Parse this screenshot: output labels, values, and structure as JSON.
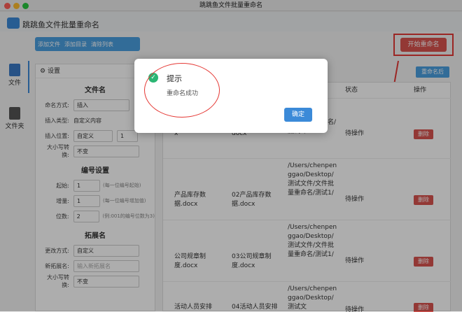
{
  "window": {
    "title": "跳跳鱼文件批量重命名"
  },
  "header": {
    "app_title": "跳跳鱼文件批量重命名"
  },
  "toolbar": {
    "add_file": "添加文件",
    "add_dir": "添加目录",
    "clear_list": "清除列表",
    "start_rename": "开始重命名"
  },
  "sidebar": {
    "items": [
      {
        "label": "文件"
      },
      {
        "label": "文件夹"
      }
    ]
  },
  "settings": {
    "header": "设置",
    "filename_section": "文件名",
    "name_mode_label": "命名方式:",
    "name_mode_value": "插入",
    "insert_type_label": "插入类型:",
    "insert_type_value": "自定义内容",
    "insert_pos_label": "插入位置:",
    "insert_pos_value": "自定义",
    "insert_pos_num": "1",
    "case_label": "大小写转换:",
    "case_value": "不变",
    "number_section": "编号设置",
    "start_label": "起始:",
    "start_value": "1",
    "start_hint": "(每一位编号起始)",
    "step_label": "增量:",
    "step_value": "1",
    "step_hint": "(每一位编号增加值)",
    "digits_label": "位数:",
    "digits_value": "2",
    "digits_hint": "(例:001的编号位数为3)",
    "ext_section": "拓展名",
    "ext_mode_label": "更改方式:",
    "ext_mode_value": "自定义",
    "new_ext_label": "新拓展名:",
    "new_ext_placeholder": "输入新拓展名",
    "ext_case_label": "大小写转换:",
    "ext_case_value": "不变"
  },
  "table": {
    "rename_status_btn": "重命名后",
    "headers": {
      "status": "状态",
      "action": "操作"
    },
    "rows": [
      {
        "name": "x",
        "newname": "docx",
        "path": "/文件批量重命名/测试1/",
        "status": "待操作",
        "action": "删除"
      },
      {
        "name": "产品库存数据.docx",
        "newname": "02产品库存数据.docx",
        "path": "/Users/chenpenggao/Desktop/测试文件/文件批量重命名/测试1/",
        "status": "待操作",
        "action": "删除"
      },
      {
        "name": "公司规章制度.docx",
        "newname": "03公司规章制度.docx",
        "path": "/Users/chenpenggao/Desktop/测试文件/文件批量重命名/测试1/",
        "status": "待操作",
        "action": "删除"
      },
      {
        "name": "活动人员安排表.docx",
        "newname": "04活动人员安排表.docx",
        "path": "/Users/chenpenggao/Desktop/测试文",
        "status": "待操作",
        "action": "删除"
      }
    ]
  },
  "dialog": {
    "title": "提示",
    "message": "重命名成功",
    "ok": "确定"
  },
  "colors": {
    "accent": "#3b8ad8",
    "danger": "#d9534f",
    "success": "#2bb673",
    "annotation": "#e53935"
  }
}
